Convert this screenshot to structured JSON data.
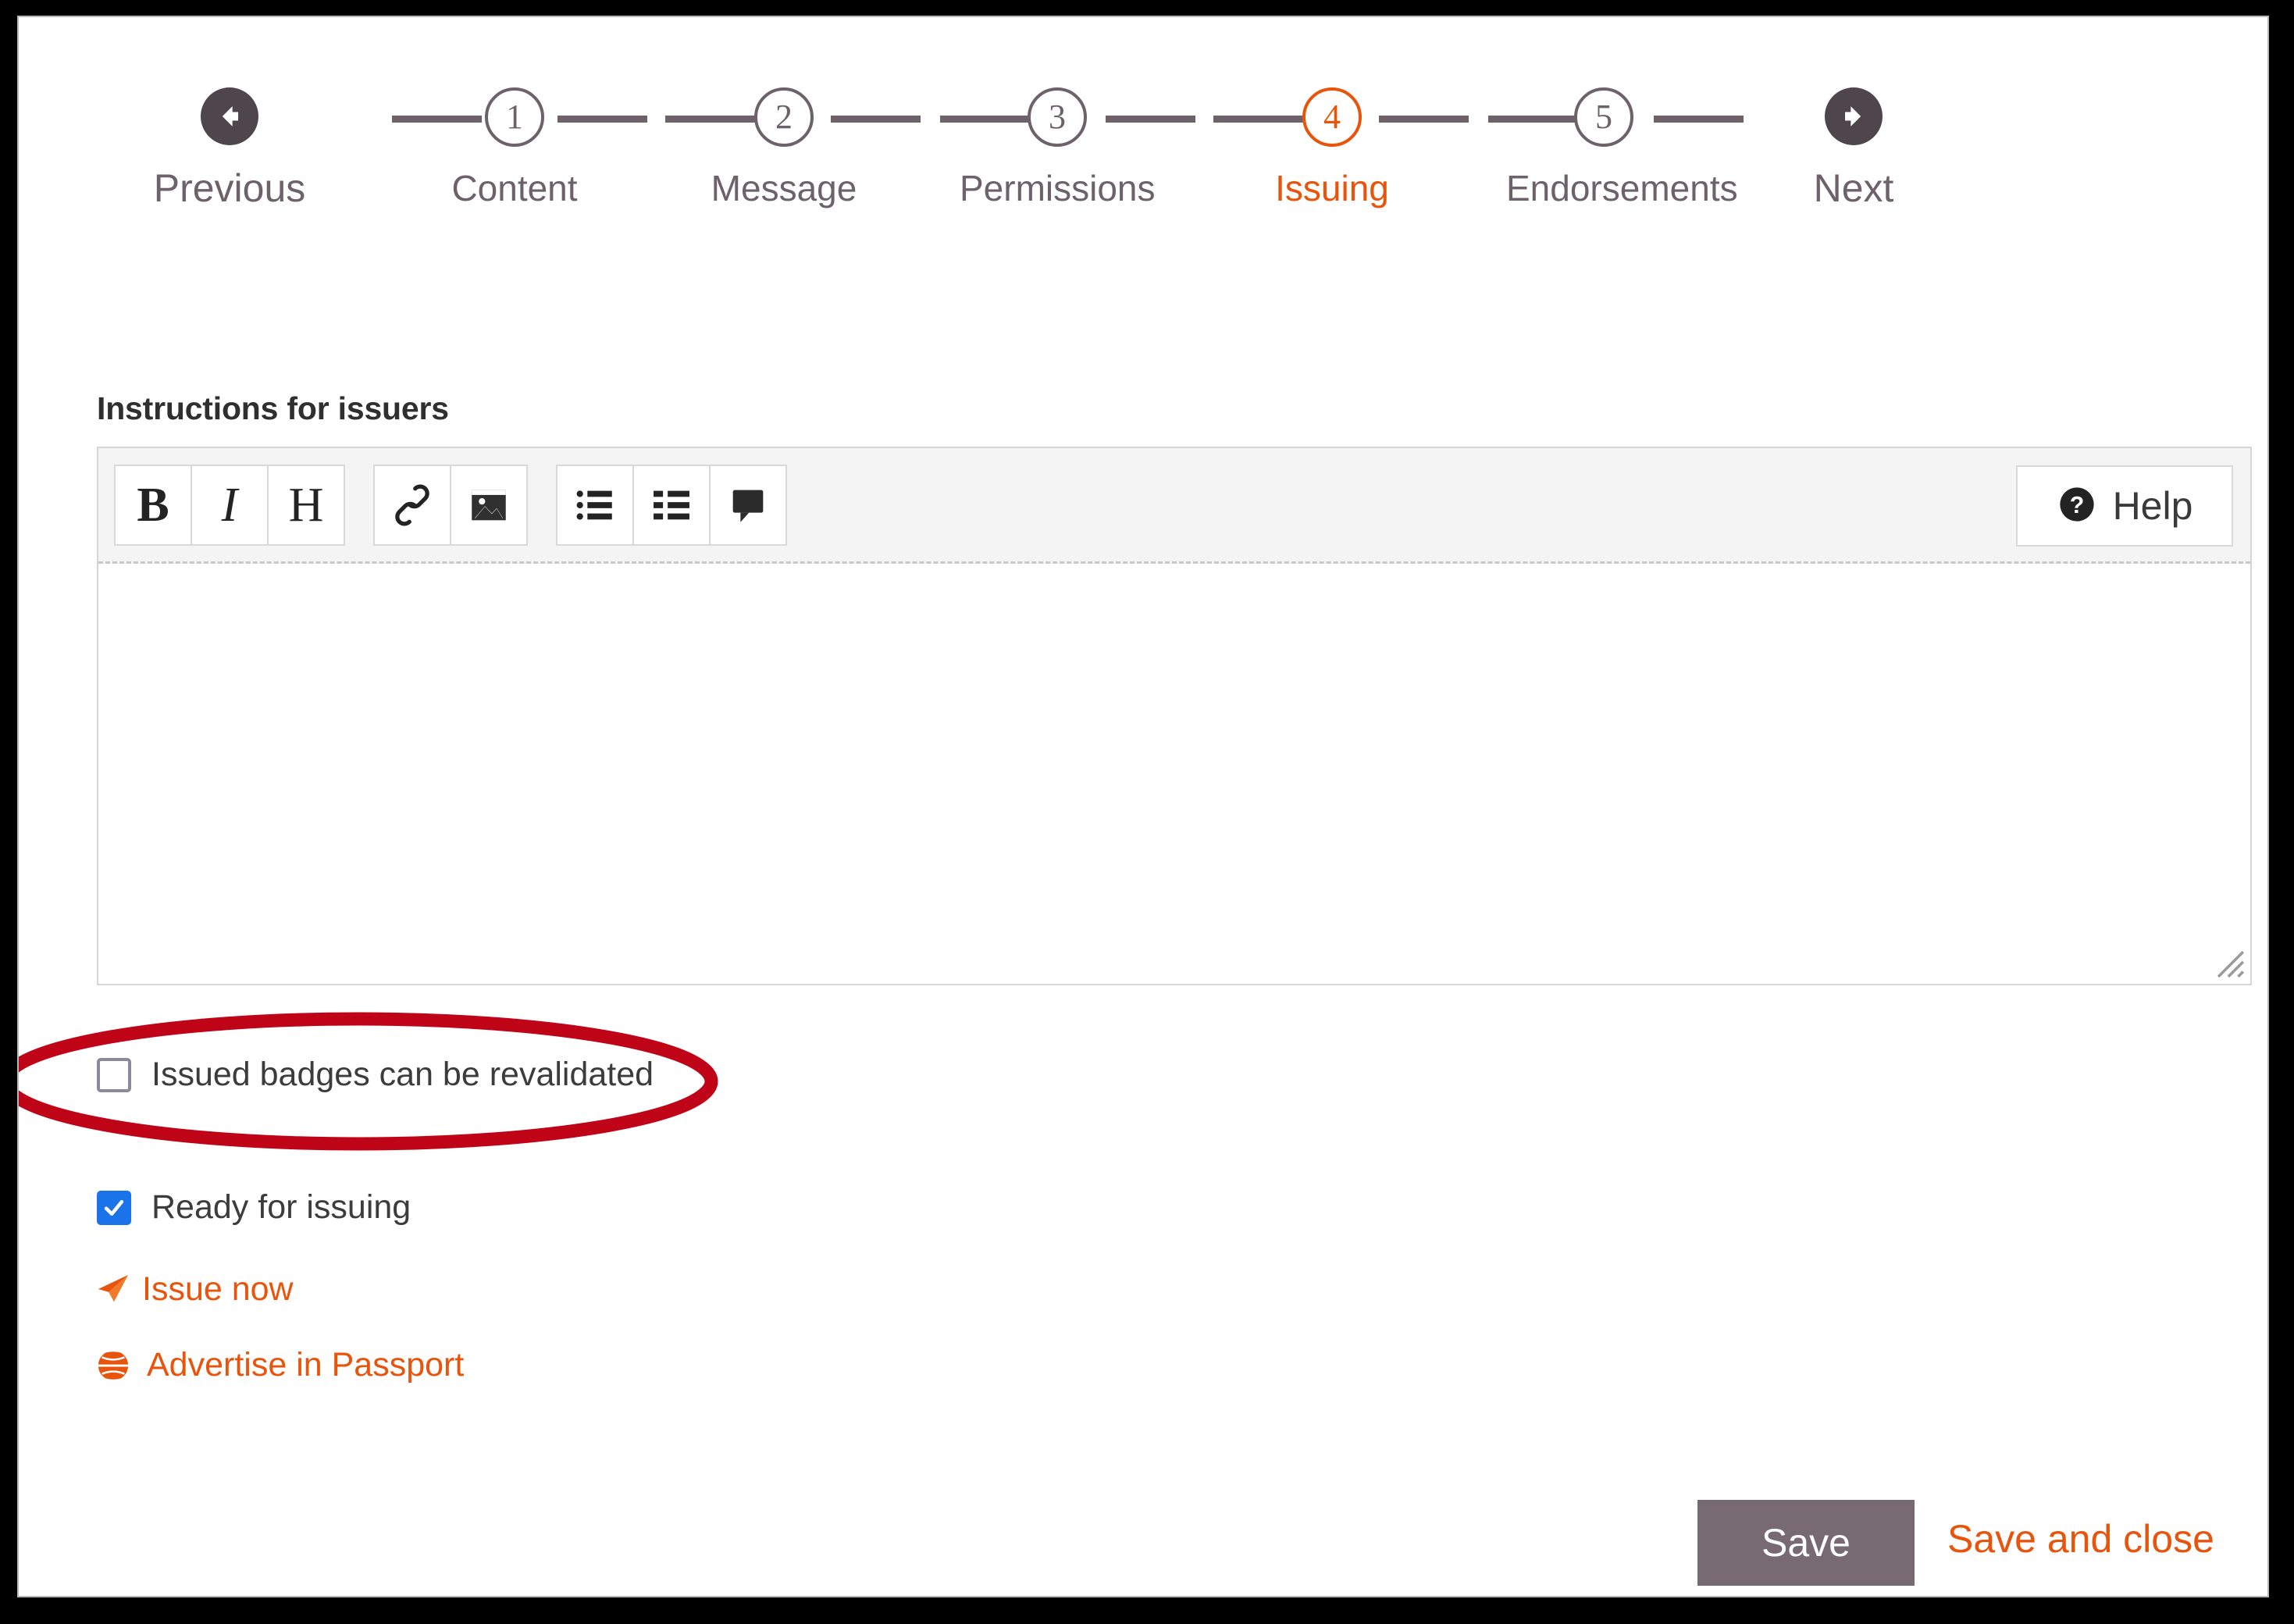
{
  "colors": {
    "accent_orange": "#e8540c",
    "step_gray": "#6d626a",
    "dark_button": "#4f464b",
    "save_button_bg": "#776a72",
    "checkbox_checked": "#1a73e8",
    "checkbox_border": "#8a8a9c",
    "annotation_red": "#c00418",
    "toolbar_bg": "#f4f4f4"
  },
  "stepper": {
    "previous": {
      "label": "Previous",
      "icon": "arrow-left-circle-icon"
    },
    "next": {
      "label": "Next",
      "icon": "arrow-right-circle-icon"
    },
    "steps": [
      {
        "number": "1",
        "label": "Content",
        "active": false
      },
      {
        "number": "2",
        "label": "Message",
        "active": false
      },
      {
        "number": "3",
        "label": "Permissions",
        "active": false
      },
      {
        "number": "4",
        "label": "Issuing",
        "active": true
      },
      {
        "number": "5",
        "label": "Endorsements",
        "active": false
      }
    ]
  },
  "form": {
    "section_label": "Instructions for issuers",
    "editor": {
      "value": "",
      "placeholder": "",
      "toolbar_groups": [
        [
          {
            "name": "bold-icon",
            "glyph": "B",
            "style": "bold",
            "title": "Bold"
          },
          {
            "name": "italic-icon",
            "glyph": "I",
            "style": "ital",
            "title": "Italic"
          },
          {
            "name": "heading-icon",
            "glyph": "H",
            "style": "",
            "title": "Heading"
          }
        ],
        [
          {
            "name": "link-icon",
            "glyph": "",
            "style": "",
            "title": "Link"
          },
          {
            "name": "image-icon",
            "glyph": "",
            "style": "",
            "title": "Image"
          }
        ],
        [
          {
            "name": "unordered-list-icon",
            "glyph": "",
            "style": "",
            "title": "Unordered list"
          },
          {
            "name": "ordered-list-icon",
            "glyph": "",
            "style": "",
            "title": "Ordered list"
          },
          {
            "name": "comment-icon",
            "glyph": "",
            "style": "",
            "title": "Comment"
          }
        ]
      ],
      "help_label": "Help",
      "help_icon": "question-circle-icon",
      "resize_handle": "resize-grip-icon"
    },
    "checkboxes": [
      {
        "label": "Issued badges can be revalidated",
        "checked": false,
        "annotated": true
      },
      {
        "label": "Ready for issuing",
        "checked": true,
        "annotated": false
      }
    ],
    "action_links": [
      {
        "label": "Issue now",
        "icon": "paper-plane-icon"
      },
      {
        "label": "Advertise in Passport",
        "icon": "globe-icon"
      }
    ]
  },
  "footer": {
    "save_label": "Save",
    "save_and_close_label": "Save and close"
  },
  "annotation": {
    "shape": "ellipse",
    "target": "Issued badges can be revalidated"
  }
}
